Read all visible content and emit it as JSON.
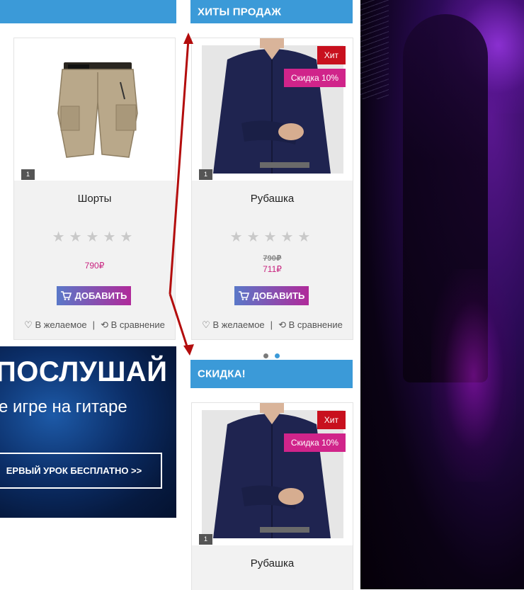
{
  "sections": {
    "top_left_bar_label": "",
    "bestsellers_title": "ХИТЫ ПРОДАЖ",
    "discount_title": "СКИДКА!"
  },
  "products": [
    {
      "name": "Шорты",
      "image_count": "1",
      "rating": 0,
      "price": "790₽",
      "add_label": "ДОБАВИТЬ",
      "wishlist_label": "В желаемое",
      "compare_label": "В сравнение"
    },
    {
      "name": "Рубашка",
      "image_count": "1",
      "rating": 0,
      "hit_badge": "Хит",
      "sale_badge": "Скидка 10%",
      "old_price": "790₽",
      "price": "711₽",
      "add_label": "ДОБАВИТЬ",
      "wishlist_label": "В желаемое",
      "compare_label": "В сравнение"
    },
    {
      "name": "Рубашка",
      "image_count": "1",
      "hit_badge": "Хит",
      "sale_badge": "Скидка 10%"
    }
  ],
  "banner": {
    "headline": "ПОСЛУШАЙ",
    "subline": "е игре на гитаре",
    "cta": "ЕРВЫЙ УРОК БЕСПЛАТНО >>"
  },
  "carousel": {
    "dots": 2,
    "active_index": 1
  },
  "colors": {
    "section_bar": "#3b9ad8",
    "price": "#c8237f",
    "hit_badge": "#c8101e",
    "sale_badge": "#d0248a",
    "annotation_arrow": "#b30d0d"
  },
  "icons": {
    "star": "star-icon",
    "cart": "cart-icon",
    "heart": "heart-icon",
    "compare": "compare-icon"
  }
}
